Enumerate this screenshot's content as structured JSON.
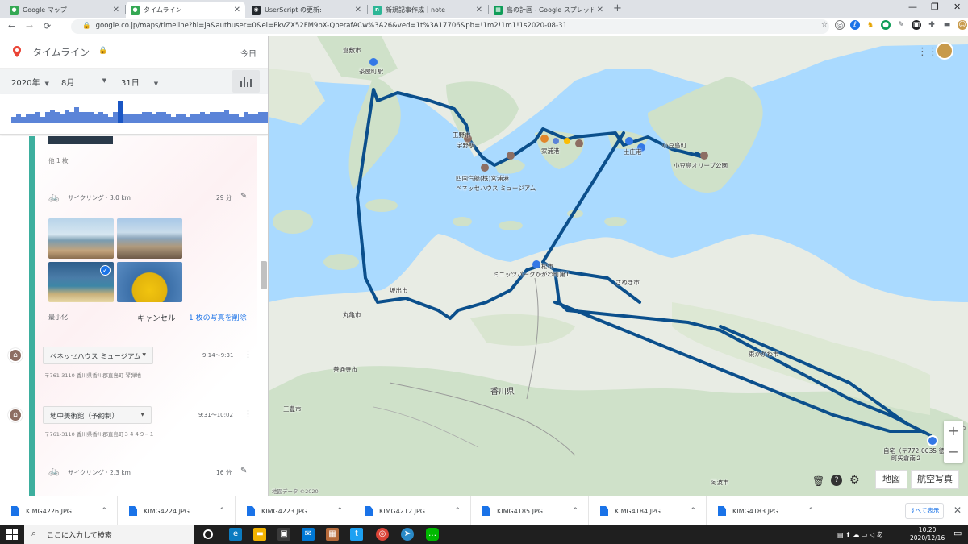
{
  "tabs": [
    {
      "label": "Google マップ",
      "icon": "maps-pin-icon",
      "color": "#34a853"
    },
    {
      "label": "タイムライン",
      "icon": "maps-pin-icon",
      "color": "#34a853"
    },
    {
      "label": "UserScript の更新:",
      "icon": "github-icon",
      "color": "#24292e"
    },
    {
      "label": "新規記事作成｜note",
      "icon": "note-icon",
      "color": "#2cb696"
    },
    {
      "label": "島の計画 - Google スプレッドシート",
      "icon": "sheets-icon",
      "color": "#0f9d58"
    }
  ],
  "address": {
    "url": "google.co.jp/maps/timeline?hl=ja&authuser=0&ei=PkvZX52FM9bX-QberafACw%3A26&ved=1t%3A17706&pb=!1m2!1m1!1s2020-08-31"
  },
  "panel": {
    "title": "タイムライン",
    "today": "今日",
    "year": "2020年",
    "month": "8月",
    "day": "31日",
    "histogram": [
      0.3,
      0.4,
      0.3,
      0.4,
      0.4,
      0.5,
      0.3,
      0.5,
      0.6,
      0.5,
      0.4,
      0.6,
      0.5,
      0.7,
      0.5,
      0.5,
      0.5,
      0.4,
      0.5,
      0.4,
      0.3,
      0.5,
      1.0,
      0.4,
      0.4,
      0.4,
      0.4,
      0.5,
      0.5,
      0.4,
      0.5,
      0.5,
      0.4,
      0.3,
      0.4,
      0.4,
      0.3,
      0.4,
      0.4,
      0.5,
      0.4,
      0.5,
      0.5,
      0.5,
      0.6,
      0.4,
      0.4,
      0.3,
      0.5,
      0.4,
      0.4,
      0.5,
      0.5
    ],
    "photo_count": "他 1 枚",
    "cycling1": {
      "label": "サイクリング · 3.0 km",
      "duration": "29 分"
    },
    "minimize": "最小化",
    "cancel": "キャンセル",
    "delete_photo": "1 枚の写真を削除",
    "place1": {
      "name": "ベネッセハウス ミュージアム",
      "time": "9:14〜9:31",
      "address": "〒761-3110 香川県香川郡直島町 琴弾地"
    },
    "place2": {
      "name": "地中美術館（予約制）",
      "time": "9:31〜10:02",
      "address": "〒761-3110 香川県香川郡直島町３４４９−１"
    },
    "cycling2": {
      "label": "サイクリング · 2.3 km",
      "duration": "16 分"
    }
  },
  "map": {
    "labels": {
      "kurashiki": "倉敷市",
      "chayamachi": "茶屋町駅",
      "tamano": "玉野市",
      "uno": "宇野駅",
      "shikoku_kisen": "四国汽船(株)宮浦港",
      "benesse_map": "ベネッセハウス ミュージアム",
      "ieura": "家浦港",
      "tonosho": "土庄港",
      "shodo": "小豆島町",
      "olive": "小豆島オリーブ公園",
      "takamatsu": "松市",
      "mini": "ミニッツパークかがわ町第1",
      "sanuki": "さぬき市",
      "sakaide": "坂出市",
      "marugame": "丸亀市",
      "zentsuji": "善通寺市",
      "kagawa": "香川県",
      "mitoyo": "三豊市",
      "higashikagawa": "東かがわ市",
      "naruto": "鳴門市",
      "home": "自宅（〒772-0035 徳",
      "home2": "町矢倉南２",
      "awa": "阿波市",
      "copyright": "地図データ ©2020"
    },
    "view_map": "地図",
    "view_satellite": "航空写真",
    "route_color": "#0b4f8c"
  },
  "downloads": {
    "files": [
      "KIMG4226.JPG",
      "KIMG4224.JPG",
      "KIMG4223.JPG",
      "KIMG4212.JPG",
      "KIMG4185.JPG",
      "KIMG4184.JPG",
      "KIMG4183.JPG"
    ],
    "show_all": "すべて表示"
  },
  "taskbar": {
    "search_placeholder": "ここに入力して検索",
    "time": "10:20",
    "date": "2020/12/16"
  }
}
